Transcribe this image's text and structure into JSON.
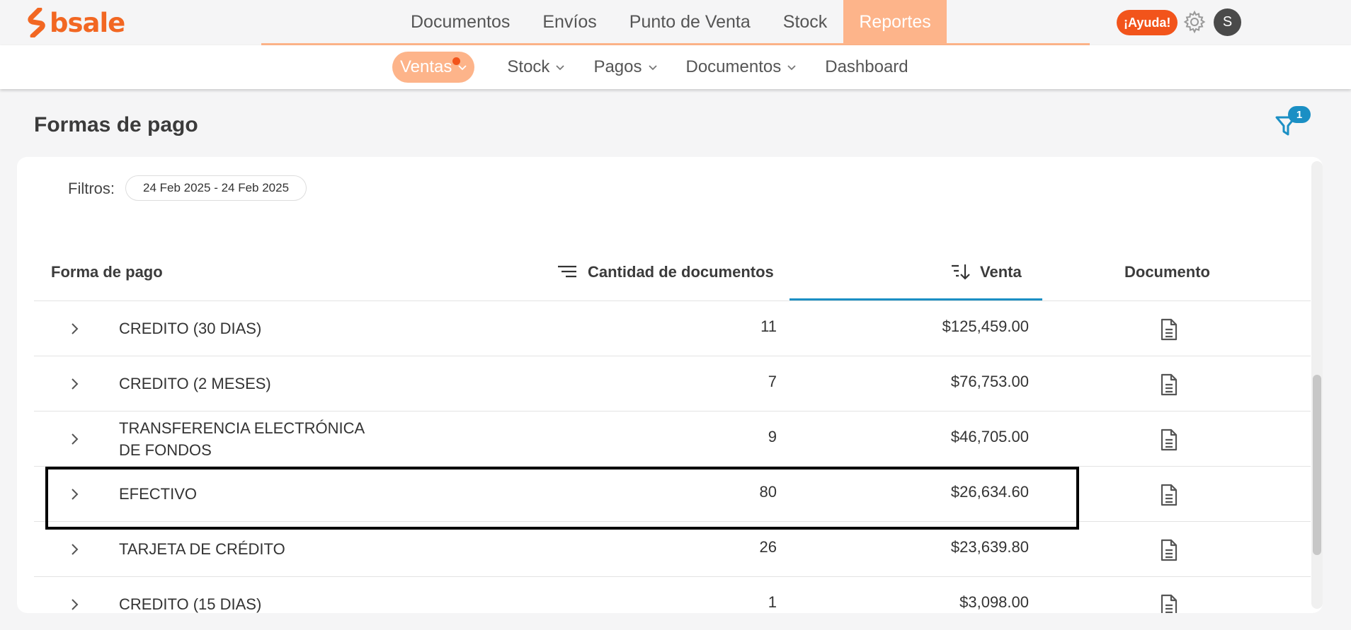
{
  "brand": {
    "name": "bsale",
    "color": "#f26722"
  },
  "main_nav": [
    {
      "label": "Documentos",
      "active": false
    },
    {
      "label": "Envíos",
      "active": false
    },
    {
      "label": "Punto de Venta",
      "active": false
    },
    {
      "label": "Stock",
      "active": false
    },
    {
      "label": "Reportes",
      "active": true
    }
  ],
  "help_label": "¡Ayuda!",
  "avatar_initial": "S",
  "sub_nav": [
    {
      "label": "Ventas",
      "active": true,
      "has_dropdown": true
    },
    {
      "label": "Stock",
      "active": false,
      "has_dropdown": true
    },
    {
      "label": "Pagos",
      "active": false,
      "has_dropdown": true
    },
    {
      "label": "Documentos",
      "active": false,
      "has_dropdown": true
    },
    {
      "label": "Dashboard",
      "active": false,
      "has_dropdown": false
    }
  ],
  "page_title": "Formas de pago",
  "filter_badge_count": "1",
  "filters": {
    "label": "Filtros:",
    "chip": "24 Feb 2025 - 24 Feb 2025"
  },
  "table": {
    "headers": {
      "payment_method": "Forma de pago",
      "doc_count": "Cantidad de documentos",
      "sale": "Venta",
      "document": "Documento"
    },
    "sorted_column": "Venta",
    "rows": [
      {
        "name": "CREDITO (30 DIAS)",
        "qty": "11",
        "sale": "$125,459.00"
      },
      {
        "name": "CREDITO (2 MESES)",
        "qty": "7",
        "sale": "$76,753.00"
      },
      {
        "name": "TRANSFERENCIA ELECTRÓNICA DE FONDOS",
        "qty": "9",
        "sale": "$46,705.00"
      },
      {
        "name": "EFECTIVO",
        "qty": "80",
        "sale": "$26,634.60",
        "highlighted": true
      },
      {
        "name": "TARJETA DE CRÉDITO",
        "qty": "26",
        "sale": "$23,639.80"
      },
      {
        "name": "CREDITO (15 DIAS)",
        "qty": "1",
        "sale": "$3,098.00"
      }
    ]
  },
  "colors": {
    "accent": "#fdb48a",
    "help": "#f2541b",
    "link": "#1b8fc4"
  }
}
